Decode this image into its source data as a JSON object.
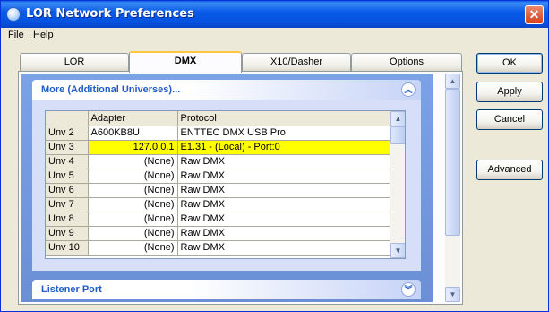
{
  "window": {
    "title": "LOR Network Preferences",
    "close_glyph": "✕"
  },
  "menu": [
    {
      "label": "File"
    },
    {
      "label": "Help"
    }
  ],
  "tabs": [
    {
      "label": "LOR",
      "active": false
    },
    {
      "label": "DMX",
      "active": true
    },
    {
      "label": "X10/Dasher",
      "active": false
    },
    {
      "label": "Options",
      "active": false
    }
  ],
  "group": {
    "title": "More (Additional Universes)...",
    "collapse_glyph": "︽",
    "grid": {
      "columns": [
        "",
        "Adapter",
        "Protocol"
      ],
      "rows": [
        {
          "universe": "Unv 2",
          "adapter": "A600KB8U",
          "protocol": "ENTTEC DMX USB Pro",
          "selected": false
        },
        {
          "universe": "Unv 3",
          "adapter": "127.0.0.1",
          "protocol": "E1.31 - (Local) - Port:0",
          "selected": true
        },
        {
          "universe": "Unv 4",
          "adapter": "(None)",
          "protocol": "Raw DMX",
          "selected": false
        },
        {
          "universe": "Unv 5",
          "adapter": "(None)",
          "protocol": "Raw DMX",
          "selected": false
        },
        {
          "universe": "Unv 6",
          "adapter": "(None)",
          "protocol": "Raw DMX",
          "selected": false
        },
        {
          "universe": "Unv 7",
          "adapter": "(None)",
          "protocol": "Raw DMX",
          "selected": false
        },
        {
          "universe": "Unv 8",
          "adapter": "(None)",
          "protocol": "Raw DMX",
          "selected": false
        },
        {
          "universe": "Unv 9",
          "adapter": "(None)",
          "protocol": "Raw DMX",
          "selected": false
        },
        {
          "universe": "Unv 10",
          "adapter": "(None)",
          "protocol": "Raw DMX",
          "selected": false
        }
      ]
    }
  },
  "group2": {
    "title": "Listener Port",
    "expand_glyph": "︾"
  },
  "buttons": {
    "ok": "OK",
    "apply": "Apply",
    "cancel": "Cancel",
    "advanced": "Advanced"
  },
  "scroll_glyphs": {
    "up": "▲",
    "down": "▼"
  },
  "colors": {
    "selected_row": "#ffff00",
    "title_bar": "#0a5be8",
    "group_title": "#215dc6"
  }
}
